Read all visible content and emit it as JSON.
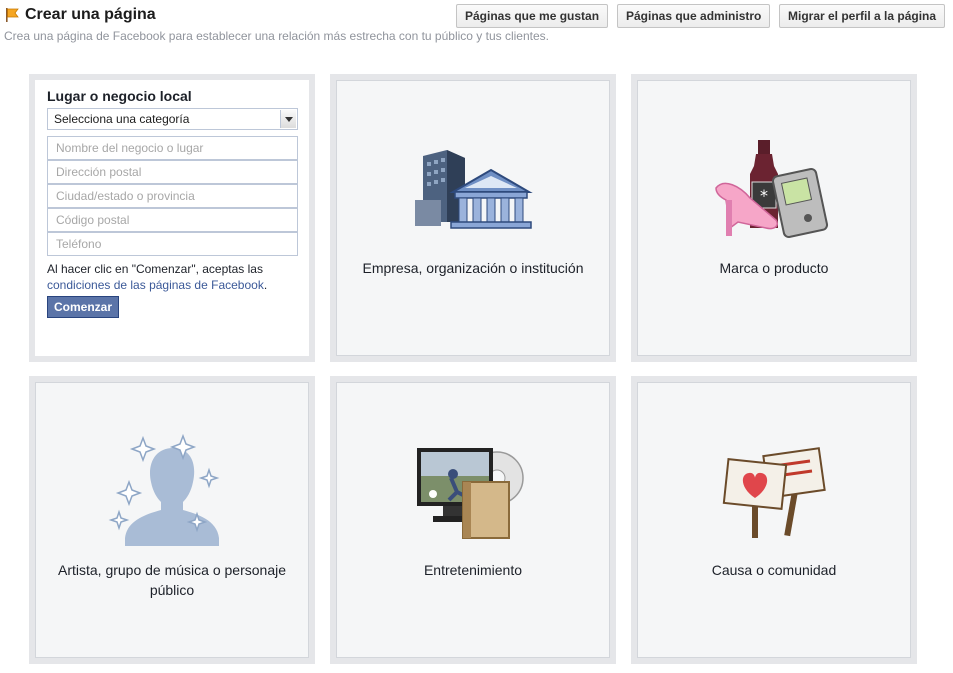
{
  "header": {
    "title": "Crear una página",
    "subtitle": "Crea una página de Facebook para establecer una relación más estrecha con tu público y tus clientes.",
    "buttons": [
      "Páginas que me gustan",
      "Páginas que administro",
      "Migrar el perfil a la página"
    ]
  },
  "form": {
    "title": "Lugar o negocio local",
    "category_select": "Selecciona una categoría",
    "placeholders": {
      "name": "Nombre del negocio o lugar",
      "address": "Dirección postal",
      "city": "Ciudad/estado o provincia",
      "zip": "Código postal",
      "phone": "Teléfono"
    },
    "terms_prefix": "Al hacer clic en \"Comenzar\", aceptas las",
    "terms_link": "condiciones de las páginas de Facebook",
    "terms_suffix": ".",
    "submit": "Comenzar"
  },
  "categories": [
    {
      "label": "Empresa, organización o institución",
      "icon": "buildings-icon"
    },
    {
      "label": "Marca o producto",
      "icon": "products-icon"
    },
    {
      "label": "Artista, grupo de música o personaje público",
      "icon": "artist-icon"
    },
    {
      "label": "Entretenimiento",
      "icon": "entertainment-icon"
    },
    {
      "label": "Causa o comunidad",
      "icon": "signs-icon"
    }
  ],
  "colors": {
    "link": "#3b5998",
    "primary_button": "#5b74a8",
    "card_bg": "#f5f6f7",
    "card_border": "#e5e6e9"
  }
}
